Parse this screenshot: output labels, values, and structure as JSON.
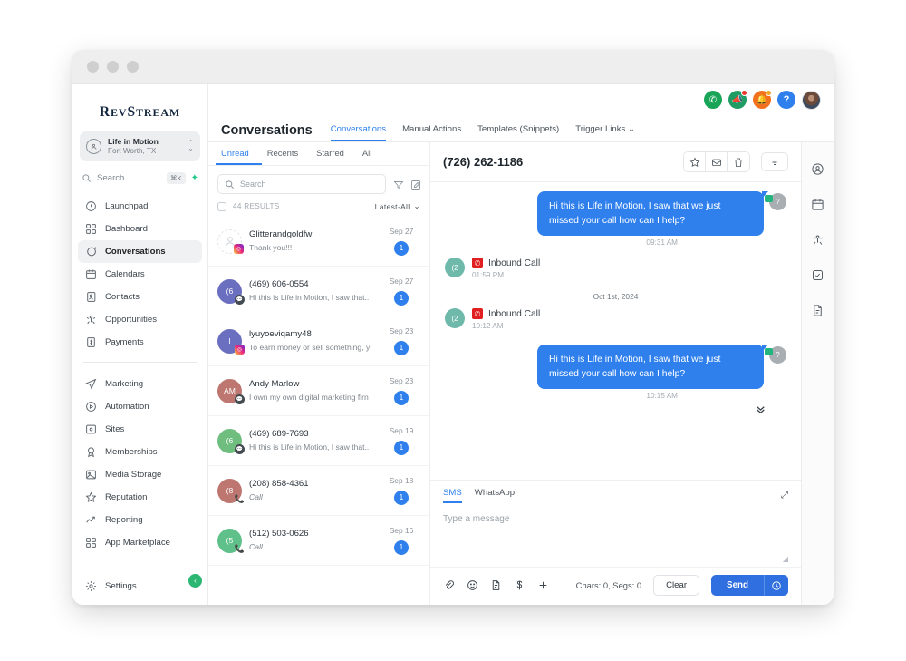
{
  "window": {
    "title": ""
  },
  "sidebar": {
    "logo": "RevStream",
    "logo_cap1": "R",
    "logo_rest1": "EV",
    "logo_cap2": "S",
    "logo_rest2": "TREAM",
    "account": {
      "name": "Life in Motion",
      "location": "Fort Worth, TX"
    },
    "search": {
      "placeholder": "Search",
      "shortcut": "⌘K"
    },
    "items": [
      {
        "label": "Launchpad",
        "icon": "rocket-icon",
        "active": false
      },
      {
        "label": "Dashboard",
        "icon": "grid-icon",
        "active": false
      },
      {
        "label": "Conversations",
        "icon": "chat-icon",
        "active": true
      },
      {
        "label": "Calendars",
        "icon": "calendar-icon",
        "active": false
      },
      {
        "label": "Contacts",
        "icon": "contacts-icon",
        "active": false
      },
      {
        "label": "Opportunities",
        "icon": "opportunities-icon",
        "active": false
      },
      {
        "label": "Payments",
        "icon": "payments-icon",
        "active": false
      }
    ],
    "items2": [
      {
        "label": "Marketing",
        "icon": "send-icon"
      },
      {
        "label": "Automation",
        "icon": "automation-icon"
      },
      {
        "label": "Sites",
        "icon": "sites-icon"
      },
      {
        "label": "Memberships",
        "icon": "badge-icon"
      },
      {
        "label": "Media Storage",
        "icon": "image-icon"
      },
      {
        "label": "Reputation",
        "icon": "star-icon"
      },
      {
        "label": "Reporting",
        "icon": "trend-icon"
      },
      {
        "label": "App Marketplace",
        "icon": "apps-icon"
      }
    ],
    "settings": {
      "label": "Settings",
      "icon": "gear-icon"
    },
    "collapse": "‹"
  },
  "topbar": {
    "icons": [
      {
        "name": "phone-icon",
        "glyph": "✆"
      },
      {
        "name": "megaphone-icon",
        "glyph": "📣"
      },
      {
        "name": "notifications-bell-icon",
        "glyph": "🔔"
      },
      {
        "name": "help-icon",
        "glyph": "?"
      }
    ]
  },
  "section": {
    "title": "Conversations",
    "tabs": [
      {
        "label": "Conversations",
        "active": true
      },
      {
        "label": "Manual Actions",
        "active": false
      },
      {
        "label": "Templates (Snippets)",
        "active": false
      },
      {
        "label": "Trigger Links",
        "active": false,
        "caret": "⌄"
      }
    ]
  },
  "list": {
    "filters": [
      {
        "label": "Unread",
        "active": true
      },
      {
        "label": "Recents",
        "active": false
      },
      {
        "label": "Starred",
        "active": false
      },
      {
        "label": "All",
        "active": false
      }
    ],
    "search_placeholder": "Search",
    "results_count": "44 RESULTS",
    "sort": "Latest-All",
    "sort_caret": "⌄",
    "conversations": [
      {
        "name": "Glitterandgoldfw",
        "preview": "Thank you!!!",
        "date": "Sep 27",
        "badge": "1",
        "avatar_initials": "",
        "avatar_color": "outline",
        "channel": "instagram",
        "italic": false
      },
      {
        "name": "(469) 606-0554",
        "preview": "Hi this is Life in Motion, I saw that..",
        "date": "Sep 27",
        "badge": "1",
        "avatar_initials": "(6",
        "avatar_color": "#6b6fbf",
        "channel": "sms",
        "italic": false
      },
      {
        "name": "lyuyoeviqamy48",
        "preview": "To earn money or sell something, y",
        "date": "Sep 23",
        "badge": "1",
        "avatar_initials": "l",
        "avatar_color": "#6b6fbf",
        "channel": "instagram",
        "italic": false
      },
      {
        "name": "Andy Marlow",
        "preview": "I own my own digital marketing firn",
        "date": "Sep 23",
        "badge": "1",
        "avatar_initials": "AM",
        "avatar_color": "#bd7770",
        "channel": "sms",
        "italic": false
      },
      {
        "name": "(469) 689-7693",
        "preview": "Hi this is Life in Motion, I saw that..",
        "date": "Sep 19",
        "badge": "1",
        "avatar_initials": "(6",
        "avatar_color": "#6fbe7f",
        "channel": "sms",
        "italic": false
      },
      {
        "name": "(208) 858-4361",
        "preview": "Call",
        "date": "Sep 18",
        "badge": "1",
        "avatar_initials": "(8",
        "avatar_color": "#bd7770",
        "channel": "call",
        "italic": true
      },
      {
        "name": "(512) 503-0626",
        "preview": "Call",
        "date": "Sep 16",
        "badge": "1",
        "avatar_initials": "(5",
        "avatar_color": "#5fc08a",
        "channel": "call",
        "italic": true
      }
    ]
  },
  "thread": {
    "phone": "(726) 262-1186",
    "actions": [
      {
        "name": "star-icon"
      },
      {
        "name": "mark-unread-icon"
      },
      {
        "name": "delete-icon"
      },
      {
        "name": "filter-icon"
      }
    ],
    "messages": [
      {
        "type": "outbound",
        "text": "Hi this is Life in Motion, I saw that we just missed your call how can I help?",
        "time": "09:31 AM",
        "avatar": "?"
      },
      {
        "type": "call",
        "label": "Inbound Call",
        "time": "01:59 PM",
        "avatar": "(2"
      },
      {
        "type": "date",
        "text": "Oct 1st, 2024"
      },
      {
        "type": "call",
        "label": "Inbound Call",
        "time": "10:12 AM",
        "avatar": "(2"
      },
      {
        "type": "outbound",
        "text": "Hi this is Life in Motion, I saw that we just missed your call how can I help?",
        "time": "10:15 AM",
        "avatar": "?"
      }
    ],
    "scroll_down": "⌄⌄"
  },
  "composer": {
    "tabs": [
      {
        "label": "SMS",
        "active": true
      },
      {
        "label": "WhatsApp",
        "active": false
      }
    ],
    "placeholder": "Type a message",
    "tools": [
      {
        "name": "attachment-icon"
      },
      {
        "name": "emoji-icon"
      },
      {
        "name": "snippet-icon"
      },
      {
        "name": "payment-icon"
      },
      {
        "name": "add-icon"
      }
    ],
    "chars": "Chars: 0, Segs: 0",
    "clear_label": "Clear",
    "send_label": "Send",
    "schedule_icon": "clock-icon"
  },
  "rail": {
    "icons": [
      {
        "name": "contact-profile-icon"
      },
      {
        "name": "calendar-icon"
      },
      {
        "name": "opportunities-icon"
      },
      {
        "name": "tasks-icon"
      },
      {
        "name": "documents-icon"
      }
    ]
  },
  "colors": {
    "accent_blue": "#2f80ed",
    "send_blue": "#2f6fe0",
    "green": "#2bb673",
    "badge_blue": "#2f80ed",
    "call_red": "#e02020"
  }
}
